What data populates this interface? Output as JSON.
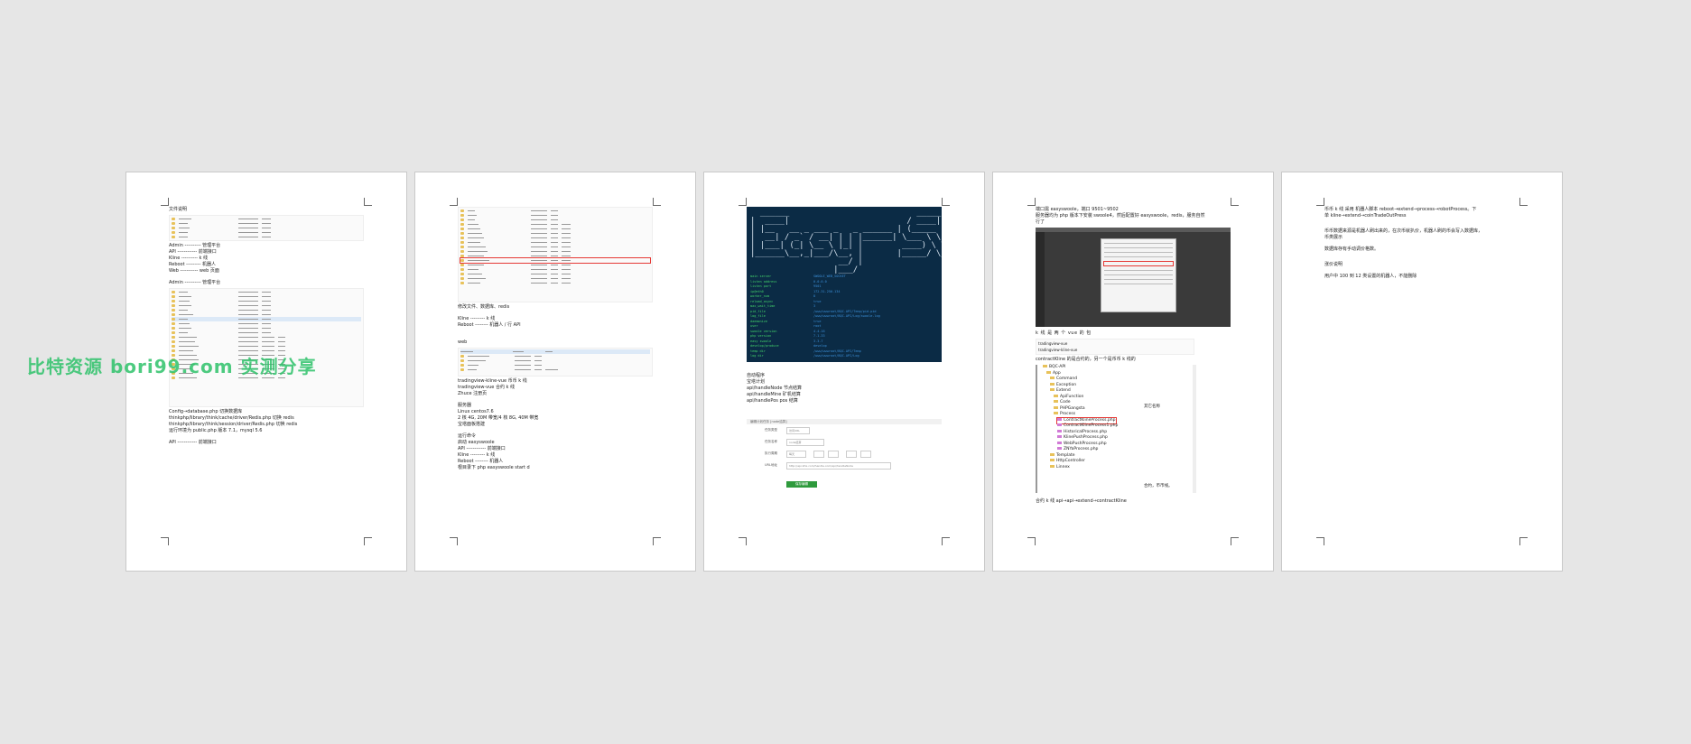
{
  "watermark": "比特资源 bori99.com 实测分享",
  "page1": {
    "title": "文件说明",
    "lines_a": [
      "Admin ---------- 管理平台",
      "API ------------  前端接口",
      "Kline ----------  k 线",
      "Reboot ---------  机器人",
      "Web -----------  web 页面"
    ],
    "admin": "Admin ---------- 管理平台",
    "config": [
      "Config→database.php  切换数据库",
      "thinkphp/library/think/cache/driver/Redis.php    切换 redis",
      "thinkphp/library/think/session/driver/Redis.php   切换 redis",
      "运行环境为 public.php 版本 7.1，mysql 5.6"
    ],
    "api": "API ------------  前端接口"
  },
  "page2": {
    "lines_a": [
      "修改文件、数据库、redis"
    ],
    "lines_b": [
      "Kline ---------  k 线",
      "Reboot --------  机器人 / 行 API"
    ],
    "web": "web",
    "lines_c": [
      "tradingview-kline-vue          币币 k 线",
      "tradingview-vue                合约 k 线",
      "Zhuce                          注册页"
    ],
    "server_title": "服务器",
    "server": [
      "Linux centos7.6",
      "2 核 4G, 20M 带宽/4 核 8G, 40M 带宽",
      "宝塔面板搭建"
    ],
    "run_title": "运行命令",
    "run": [
      "启动 easyswoole",
      "API ------------  前端接口",
      "Kline ---------  k 线",
      "Reboot --------  机器人",
      "根目录下  php easyswoole start d"
    ]
  },
  "page3": {
    "terminal_art": [
      "  ______                          _____                    _      ",
      "|  ____|                        / ____|                  | |     ",
      "| |__   __ _ ___ _   _ ______ | (_____      _____   ___ | | ___ ",
      "|  __| / _` / __| | | |______| \\___ \\ \\ /\\ / / _ \\ / _ \\| |/ _ \\",
      "| |___| (_| \\__ \\ |_| |        ____) \\ V  V / (_) | (_) | |  __/",
      "|______\\__,_|___/\\__, |       |_____/ \\_/\\_/ \\___/ \\___/|_|\\___|",
      "                  __/ |                                          ",
      "                 |___/                                           "
    ],
    "config_rows": [
      {
        "k": "main server",
        "v": "SWOOLE_WEB_SOCKET"
      },
      {
        "k": "listen address",
        "v": "0.0.0.0"
      },
      {
        "k": "listen port",
        "v": "9501"
      },
      {
        "k": "ip@eth0",
        "v": "172.31.250.134"
      },
      {
        "k": "worker_num",
        "v": "8"
      },
      {
        "k": "reload_async",
        "v": "true"
      },
      {
        "k": "max_wait_time",
        "v": "3"
      },
      {
        "k": "pid_file",
        "v": "/www/wwwroot/BQC-API/Temp/pid.pid"
      },
      {
        "k": "log_file",
        "v": "/www/wwwroot/BQC-API/Log/swoole.log"
      },
      {
        "k": "daemonize",
        "v": "true"
      },
      {
        "k": "user",
        "v": "root"
      },
      {
        "k": "swoole version",
        "v": "4.4.16"
      },
      {
        "k": "php version",
        "v": "7.1.33"
      },
      {
        "k": "easy swoole",
        "v": "3.3.7"
      },
      {
        "k": "develop/produce",
        "v": "develop"
      },
      {
        "k": "temp dir",
        "v": "/www/wwwroot/BQC-API/Temp"
      },
      {
        "k": "log dir",
        "v": "/www/wwwroot/BQC-API/Log"
      }
    ],
    "auto_title": "自动程序",
    "auto_sub": "宝塔计划",
    "auto": [
      "api/handleNode  节点结算",
      "api/handleMine  矿机结算",
      "api/handlePos   pos 结算"
    ],
    "form_head": "编辑计划任务 [node结算]",
    "form": {
      "type_label": "任务类型",
      "type_value": "访问URL",
      "name_label": "任务名称",
      "name_value": "node结算",
      "cycle_label": "执行周期",
      "cycle_value": "每天",
      "url_label": "URL地址",
      "url_value": "http://api.bhx.com/handle.com/api/handleNode",
      "submit": "保存编辑"
    }
  },
  "page4": {
    "lines_a": [
      "端口需 easyswoole，端口 9501~9502",
      "服务器均为 php 版本下安装 swoole4，然后配置好 easyswoole，redis，服务自然",
      "行了"
    ],
    "kline_line": "k    线    是    两    个    vue    的    包",
    "kline_files": [
      "tradingview-vue",
      "tradingview-kline-vue"
    ],
    "kline_note": "其它名称",
    "contract": "contractKline 的是合约的，另一个是币币 k 线的",
    "tree": [
      "BQC-API",
      "App",
      "Command",
      "Exception",
      "Extend",
      "ApiFunction",
      "Code",
      "PHPGangsta",
      "Process",
      "ContractKlineProcess.php",
      "ContractKlineProcess1.php",
      "HistoricalProcess.php",
      "KlinePushProcess.php",
      "WebPushProcess.php",
      "ZNYaProcess.php",
      "Template",
      "HttpController",
      "Linnex"
    ],
    "tree_note": "合约，币币线。",
    "bottom": "合约 k 线    api→api→extend→contractKline"
  },
  "page5": {
    "lines": [
      "币币 k 线    采用    机器人脚本    reboot→extend→process→robotProcess。下",
      "单    kline→extend→coinTradeOutPress"
    ],
    "p2": [
      "币币数据来源是机器人刷出来的，在次币就扒价，机器人刷的币会写入数据库，",
      "币类展示"
    ],
    "p3": "数据库存有手动调价格数。",
    "p4_title": "涨价说明",
    "p4": "用户中 100 到 12 类设置的机器人，不能删除"
  }
}
